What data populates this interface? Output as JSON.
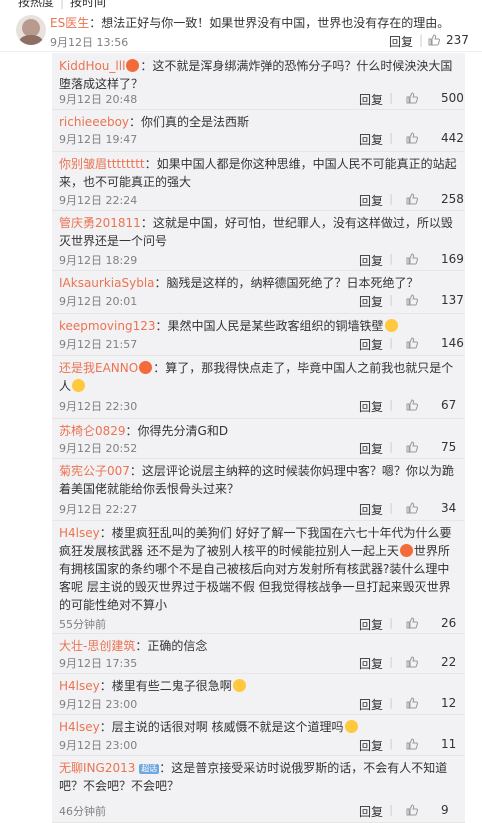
{
  "tabs": {
    "hot": "按热度",
    "sep": "|",
    "time": "按时间"
  },
  "top_comment": {
    "user": "ES医生",
    "text": "：想法正好与你一致！如果世界没有中国，世界也没有存在的理由。",
    "time": "9月12日 13:56",
    "reply": "回复",
    "likes": "237"
  },
  "replies": [
    {
      "user": "KiddHou_lll",
      "emoji": true,
      "text": "：这不就是浑身绑满炸弹的恐怖分子吗？什么时候泱泱大国堕落成这样了？",
      "time": "9月12日 20:48",
      "reply": "回复",
      "likes": "500"
    },
    {
      "user": "richieeeboy",
      "text": "：你们真的全是法西斯",
      "time": "9月12日 19:47",
      "reply": "回复",
      "likes": "442"
    },
    {
      "user": "你别皱眉tttttttt",
      "text": "：如果中国人都是你这种思维，中国人民不可能真正的站起来，也不可能真正的强大",
      "time": "9月12日 22:24",
      "reply": "回复",
      "likes": "258"
    },
    {
      "user": "管庆勇201811",
      "text": "：这就是中国，好可怕，世纪罪人，没有这样做过，所以毁灭世界还是一个问号",
      "time": "9月12日 18:29",
      "reply": "回复",
      "likes": "169"
    },
    {
      "user": "IAksaurkiaSybla",
      "text": "：脑残是这样的，纳粹德国死绝了？日本死绝了？",
      "time": "9月12日 20:01",
      "reply": "回复",
      "likes": "137"
    },
    {
      "user": "keepmoving123",
      "text": "：果然中国人民是某些政客组织的铜墙铁壁",
      "emoji_end": true,
      "time": "9月12日 21:57",
      "reply": "回复",
      "likes": "146"
    },
    {
      "user": "还是我EANNO",
      "emoji": true,
      "text": "：算了，那我得快点走了，毕竟中国人之前我也就只是个人",
      "emoji_end": true,
      "time": "9月12日 22:30",
      "reply": "回复",
      "likes": "67"
    },
    {
      "user": "苏椅仑0829",
      "text": "：你得先分清G和D",
      "time": "9月12日 20:52",
      "reply": "回复",
      "likes": "75"
    },
    {
      "user": "菊宪公子007",
      "text": "：这层评论说层主纳粹的这时候装你妈理中客？嗯？你以为跪着美国佬就能给你丢恨骨头过来？",
      "time": "9月12日 22:27",
      "reply": "回复",
      "likes": "34"
    },
    {
      "user": "H4lsey",
      "text": "：楼里疯狂乱叫的美狗们 好好了解一下我国在六七十年代为什么要疯狂发展核武器 还不是为了被别人核平的时候能拉别人一起上天",
      "emoji_mid": true,
      "text2": "世界所有拥核国家的条约哪个不是自己被核后向对方发射所有核武器?装什么理中客呢 层主说的毁灭世界过于极端不假 但我觉得核战争一旦打起来毁灭世界的可能性绝对不算小",
      "time": "55分钟前",
      "reply": "回复",
      "likes": "26"
    },
    {
      "user": "大壮-思创建筑",
      "text": "：正确的信念",
      "time": "9月12日 17:35",
      "reply": "回复",
      "likes": "22"
    },
    {
      "user": "H4lsey",
      "text": "：楼里有些二鬼子很急啊",
      "emoji_end": true,
      "time": "9月12日 23:00",
      "reply": "回复",
      "likes": "12"
    },
    {
      "user": "H4lsey",
      "text": "：层主说的话很对啊 核威慑不就是这个道理吗",
      "emoji_end": true,
      "time": "9月12日 23:00",
      "reply": "回复",
      "likes": "11"
    },
    {
      "user": "无聊ING2013",
      "badge": "超话",
      "text": "：这是普京接受采访时说俄罗斯的话，不会有人不知道吧？不会吧？不会吧？",
      "time": "46分钟前",
      "reply": "回复",
      "likes": "9"
    }
  ],
  "colors": {
    "username": "#eb7350",
    "meta": "#808080",
    "panel_bg": "#f2f2f5"
  }
}
